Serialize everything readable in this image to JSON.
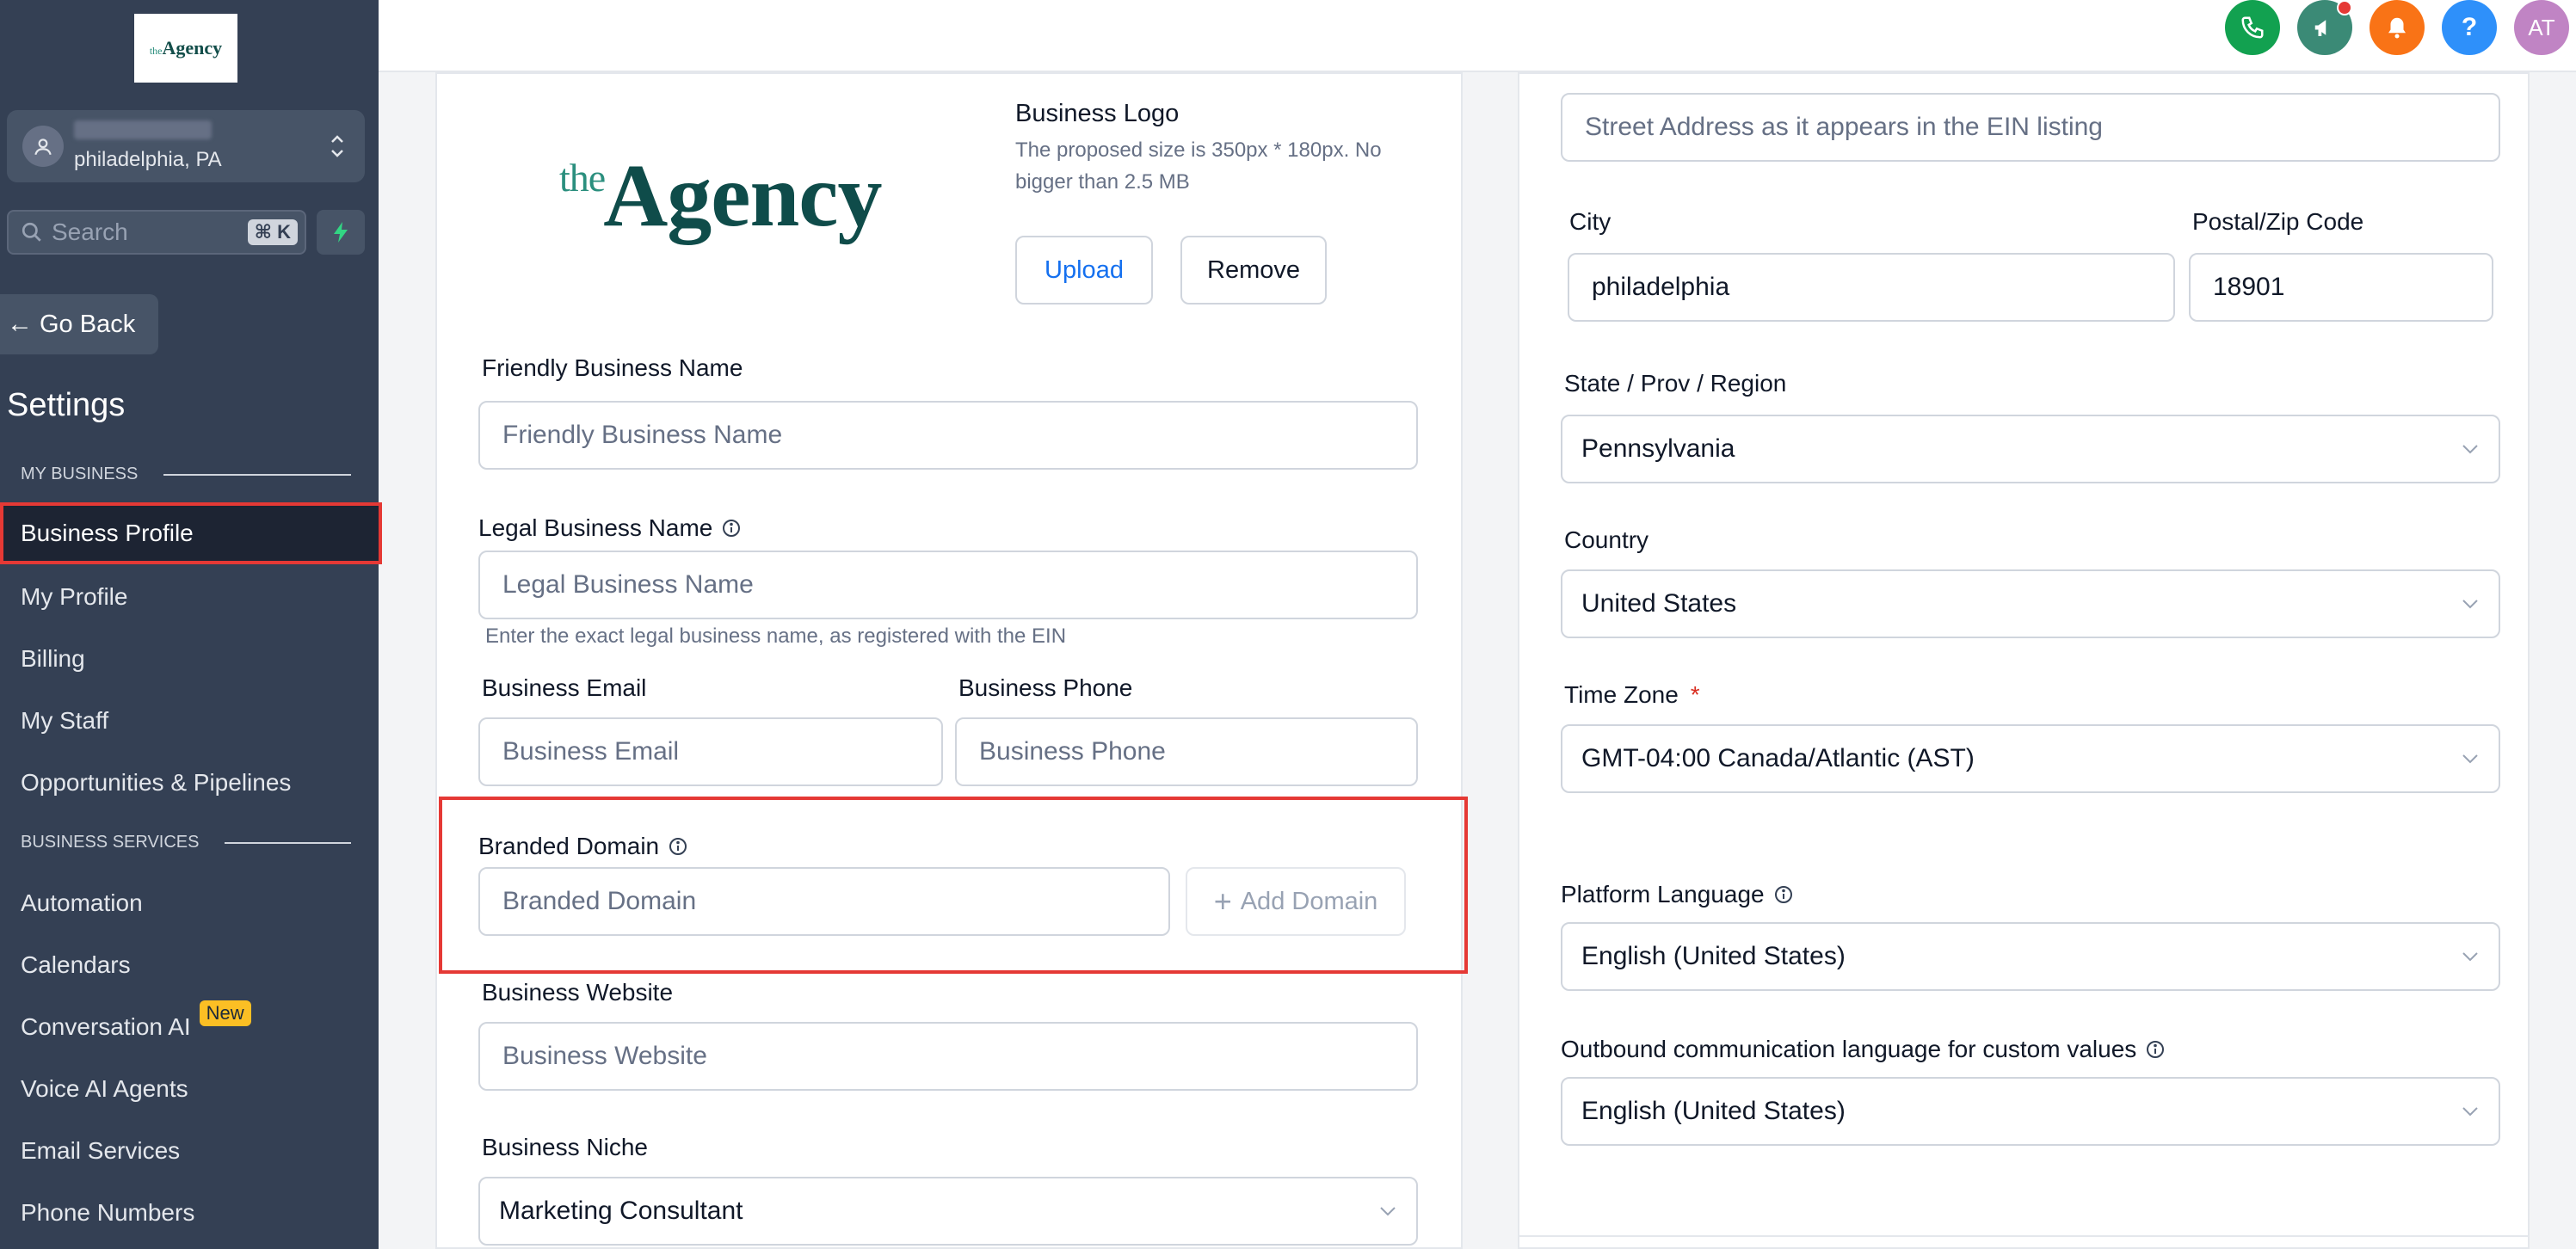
{
  "sidebar": {
    "logo_text_the": "the",
    "logo_text_main": "Agency",
    "location_city": "philadelphia, PA",
    "search_placeholder": "Search",
    "search_shortcut": "⌘ K",
    "go_back": "Go Back",
    "settings_title": "Settings",
    "section_my_business": "MY BUSINESS",
    "section_business_services": "BUSINESS SERVICES",
    "items": [
      {
        "label": "Business Profile"
      },
      {
        "label": "My Profile"
      },
      {
        "label": "Billing"
      },
      {
        "label": "My Staff"
      },
      {
        "label": "Opportunities & Pipelines"
      },
      {
        "label": "Automation"
      },
      {
        "label": "Calendars"
      },
      {
        "label": "Conversation AI",
        "badge": "New"
      },
      {
        "label": "Voice AI Agents"
      },
      {
        "label": "Email Services"
      },
      {
        "label": "Phone Numbers"
      }
    ]
  },
  "topbar": {
    "help_label": "?",
    "avatar_initials": "AT",
    "colors": {
      "phone": "#12a150",
      "megaphone": "#3b8a76",
      "bell": "#f97316",
      "help": "#2e90fa",
      "avatar": "#c084c4"
    }
  },
  "logo_section": {
    "logo_the": "the",
    "logo_main": "Agency",
    "title": "Business Logo",
    "description": "The proposed size is 350px * 180px. No bigger than 2.5 MB",
    "upload": "Upload",
    "remove": "Remove"
  },
  "form_left": {
    "friendly_name_label": "Friendly Business Name",
    "friendly_name_placeholder": "Friendly Business Name",
    "legal_name_label": "Legal Business Name",
    "legal_name_placeholder": "Legal Business Name",
    "legal_name_help": "Enter the exact legal business name, as registered with the EIN",
    "email_label": "Business Email",
    "email_placeholder": "Business Email",
    "phone_label": "Business Phone",
    "phone_placeholder": "Business Phone",
    "branded_domain_label": "Branded Domain",
    "branded_domain_placeholder": "Branded Domain",
    "add_domain": "Add Domain",
    "website_label": "Business Website",
    "website_placeholder": "Business Website",
    "niche_label": "Business Niche",
    "niche_value": "Marketing Consultant"
  },
  "form_right": {
    "street_placeholder": "Street Address as it appears in the EIN listing",
    "city_label": "City",
    "city_value": "philadelphia",
    "zip_label": "Postal/Zip Code",
    "zip_value": "18901",
    "state_label": "State / Prov / Region",
    "state_value": "Pennsylvania",
    "country_label": "Country",
    "country_value": "United States",
    "timezone_label": "Time Zone",
    "timezone_required": "*",
    "timezone_value": "GMT-04:00 Canada/Atlantic (AST)",
    "platform_language_label": "Platform Language",
    "platform_language_value": "English (United States)",
    "outbound_language_label": "Outbound communication language for custom values",
    "outbound_language_value": "English (United States)"
  }
}
